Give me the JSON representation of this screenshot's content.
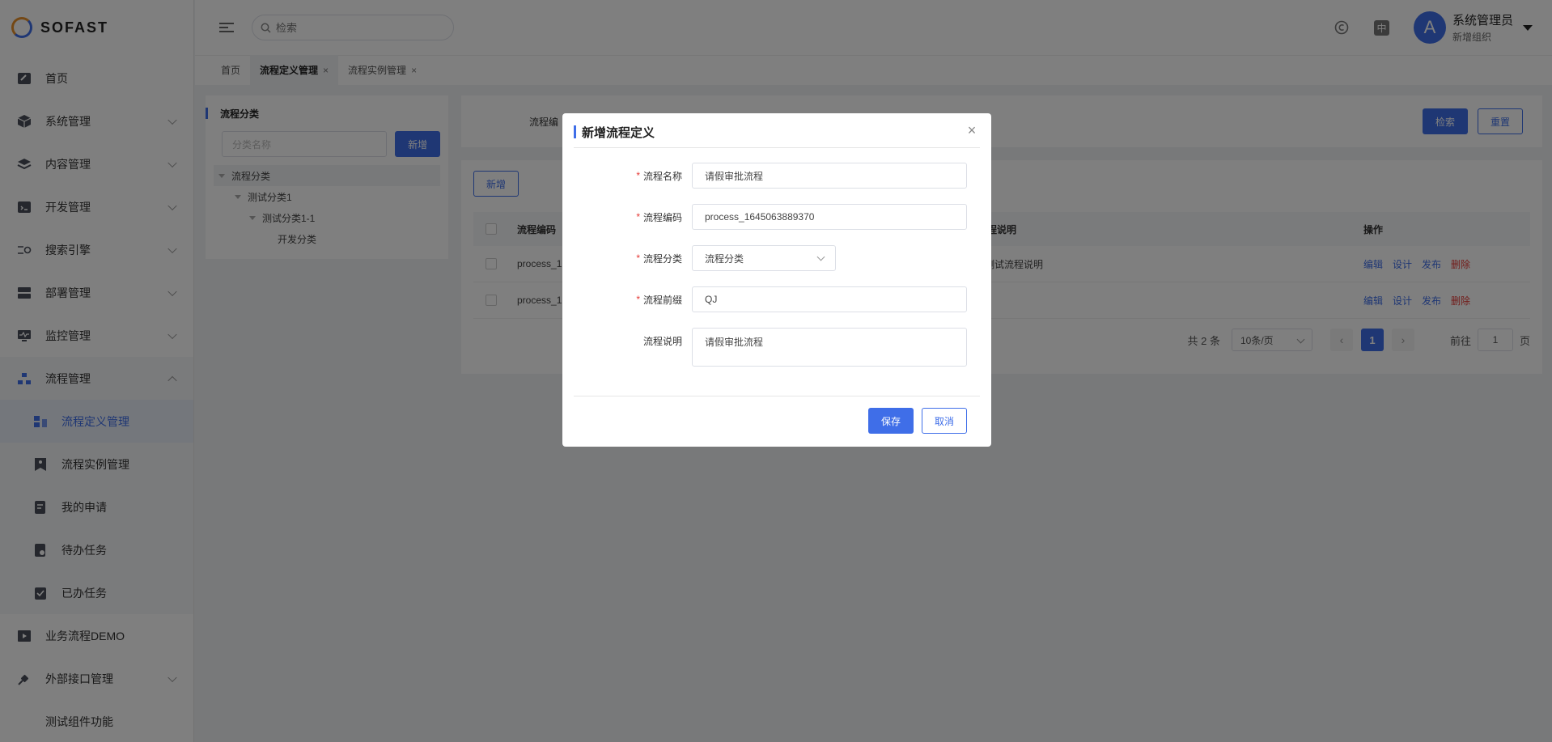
{
  "brand": {
    "name": "SOFAST"
  },
  "sidebar": {
    "items": [
      {
        "label": "首页",
        "icon": "home-icon"
      },
      {
        "label": "系统管理",
        "icon": "cube-icon"
      },
      {
        "label": "内容管理",
        "icon": "layers-icon"
      },
      {
        "label": "开发管理",
        "icon": "code-icon"
      },
      {
        "label": "搜索引擎",
        "icon": "search-engine-icon"
      },
      {
        "label": "部署管理",
        "icon": "server-icon"
      },
      {
        "label": "监控管理",
        "icon": "monitor-icon"
      },
      {
        "label": "流程管理",
        "icon": "flow-icon"
      }
    ],
    "sub_items": [
      {
        "label": "流程定义管理",
        "icon": "flow-definition-icon"
      },
      {
        "label": "流程实例管理",
        "icon": "flow-instance-icon"
      },
      {
        "label": "我的申请",
        "icon": "apply-icon"
      },
      {
        "label": "待办任务",
        "icon": "todo-icon"
      },
      {
        "label": "已办任务",
        "icon": "done-icon"
      }
    ],
    "bottom_items": [
      {
        "label": "业务流程DEMO",
        "icon": "play-icon"
      },
      {
        "label": "外部接口管理",
        "icon": "plug-icon"
      },
      {
        "label": "测试组件功能"
      }
    ]
  },
  "header": {
    "search_placeholder": "检索",
    "lang_label": "中",
    "user_initial": "A",
    "user_name": "系统管理员",
    "user_org": "新增组织"
  },
  "tabs": [
    {
      "label": "首页"
    },
    {
      "label": "流程定义管理",
      "close": "×"
    },
    {
      "label": "流程实例管理",
      "close": "×"
    }
  ],
  "category": {
    "title": "流程分类",
    "search_placeholder": "分类名称",
    "add_label": "新增",
    "tree": [
      "流程分类",
      "测试分类1",
      "测试分类1-1",
      "开发分类"
    ]
  },
  "filter": {
    "label_partial": "流程编",
    "search_label": "检索",
    "reset_label": "重置"
  },
  "list": {
    "add_label": "新增",
    "columns": [
      "流程编码",
      "程说明",
      "操作"
    ],
    "rows": [
      {
        "code": "process_1",
        "desc": "测试流程说明"
      },
      {
        "code": "process_1",
        "desc": ""
      }
    ],
    "actions": {
      "edit": "编辑",
      "design": "设计",
      "publish": "发布",
      "delete": "删除"
    },
    "pagination": {
      "total": "共 2 条",
      "page_size": "10条/页",
      "prev": "‹",
      "current": "1",
      "next": "›",
      "goto": "前往",
      "goto_value": "1",
      "page_suffix": "页"
    }
  },
  "modal": {
    "title": "新增流程定义",
    "close": "×",
    "fields": {
      "name": {
        "label": "流程名称",
        "value": "请假审批流程",
        "required": "*"
      },
      "code": {
        "label": "流程编码",
        "value": "process_1645063889370",
        "required": "*"
      },
      "category": {
        "label": "流程分类",
        "value": "流程分类",
        "required": "*"
      },
      "prefix": {
        "label": "流程前缀",
        "value": "QJ",
        "required": "*"
      },
      "desc": {
        "label": "流程说明",
        "value": "请假审批流程"
      }
    },
    "save_label": "保存",
    "cancel_label": "取消"
  },
  "colors": {
    "accent": "#3f6ee8",
    "danger": "#e53935"
  }
}
